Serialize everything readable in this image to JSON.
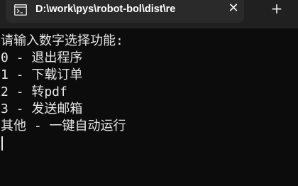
{
  "tab": {
    "icon": "terminal-icon",
    "title": "D:\\work\\pys\\robot-bol\\dist\\re",
    "close_label": "✕",
    "new_tab_label": "+"
  },
  "terminal": {
    "lines": [
      "请输入数字选择功能:",
      "0 - 退出程序",
      "1 - 下载订单",
      "2 - 转pdf",
      "3 - 发送邮箱",
      "其他 - 一键自动运行"
    ]
  },
  "colors": {
    "background": "#0c0c0c",
    "tabbar": "#202020",
    "tab": "#2a2a2a",
    "text": "#e6e6e6"
  }
}
